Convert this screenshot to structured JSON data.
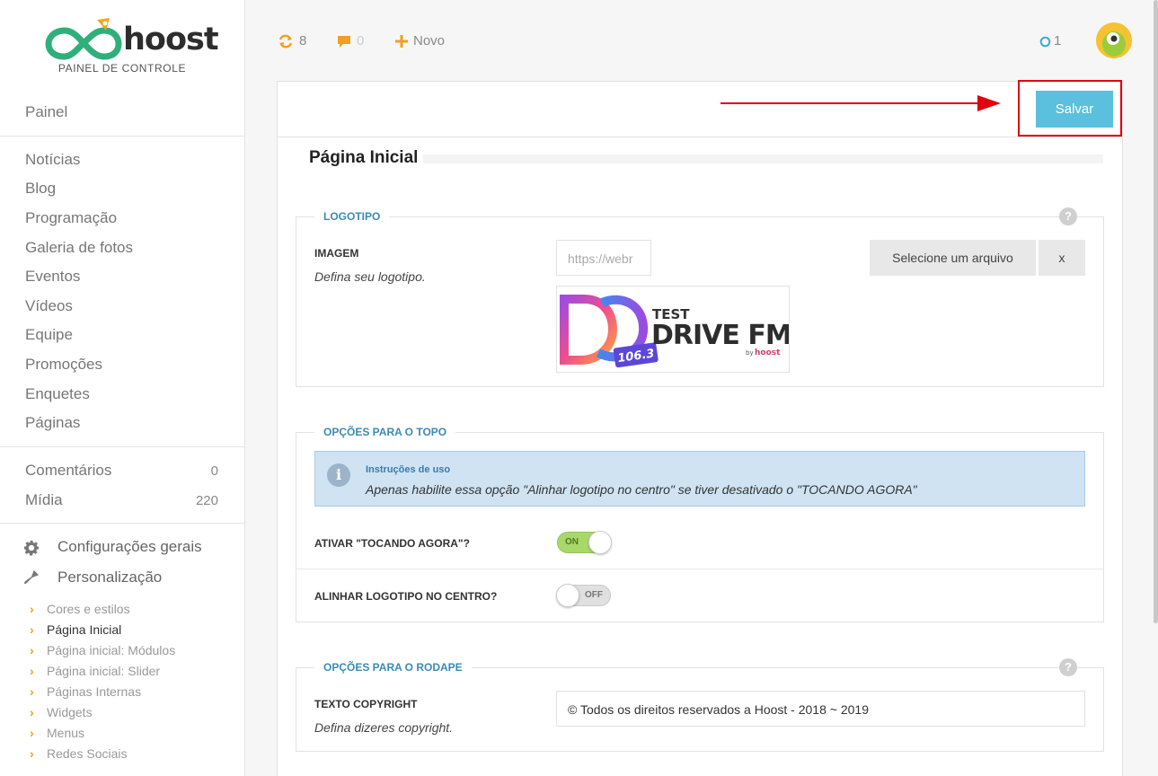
{
  "brand": {
    "name": "hoost",
    "subtitle": "PAINEL DE CONTROLE"
  },
  "sidebar": {
    "top": "Painel",
    "content_items": [
      "Notícias",
      "Blog",
      "Programação",
      "Galeria de fotos",
      "Eventos",
      "Vídeos",
      "Equipe",
      "Promoções",
      "Enquetes",
      "Páginas"
    ],
    "stats": [
      {
        "label": "Comentários",
        "count": "0"
      },
      {
        "label": "Mídia",
        "count": "220"
      }
    ],
    "config": {
      "general": "Configurações gerais",
      "custom": "Personalização"
    },
    "sub_items": [
      "Cores e estilos",
      "Página Inicial",
      "Página inicial: Módulos",
      "Página inicial: Slider",
      "Páginas Internas",
      "Widgets",
      "Menus",
      "Redes Sociais"
    ],
    "active_sub": "Página Inicial"
  },
  "topbar": {
    "updates_count": "8",
    "comments_count": "0",
    "new_label": "Novo",
    "online_count": "1"
  },
  "toolbar": {
    "save_label": "Salvar"
  },
  "page": {
    "title": "Página Inicial"
  },
  "logo_section": {
    "legend": "LOGOTIPO",
    "field_label": "IMAGEM",
    "field_desc": "Defina seu logotipo.",
    "url_value": "https://webr",
    "select_file": "Selecione um arquivo",
    "clear": "x",
    "preview": {
      "top": "TEST",
      "main": "DRIVE FM",
      "freq": "106.3",
      "by": "by",
      "by_brand": "hoost"
    }
  },
  "top_options": {
    "legend": "OPÇÕES PARA O TOPO",
    "info_title": "Instruções de uso",
    "info_text": "Apenas habilite essa opção \"Alinhar logotipo no centro\" se tiver desativado o \"TOCANDO AGORA\"",
    "now_playing_label": "ATIVAR \"TOCANDO AGORA\"?",
    "now_playing_state": "ON",
    "center_logo_label": "ALINHAR LOGOTIPO NO CENTRO?",
    "center_logo_state": "OFF"
  },
  "footer_options": {
    "legend": "OPÇÕES PARA O RODAPE",
    "field_label": "TEXTO COPYRIGHT",
    "field_desc": "Defina dizeres copyright.",
    "copyright_value": "© Todos os direitos reservados a Hoost - 2018 ~ 2019"
  },
  "colors": {
    "accent": "#5bc0de",
    "highlight": "#e0000f",
    "orange": "#f0a020",
    "link_blue": "#3b8ab7"
  }
}
